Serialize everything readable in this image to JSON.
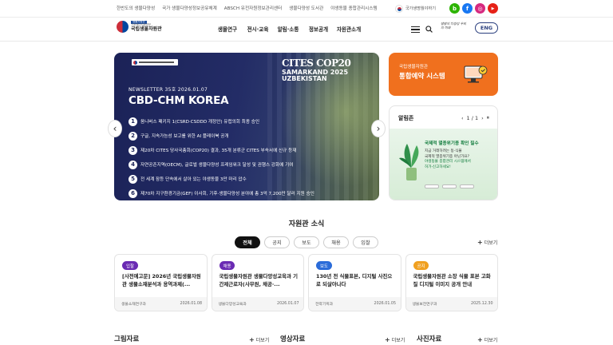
{
  "util": {
    "links": [
      "한반도의 생물다양성",
      "국가 생물다양성정보공유체계",
      "ABSCH 유전자원정보관리센터",
      "생물다양성 도서관",
      "야생동물 종합관리시스템"
    ],
    "lang_label": "국가생명월야하기",
    "sns": [
      {
        "icon": "blog-icon",
        "glyph": "b",
        "color": "#2db400"
      },
      {
        "icon": "facebook-icon",
        "glyph": "f",
        "color": "#1877f2"
      },
      {
        "icon": "instagram-icon",
        "glyph": "◎",
        "color": "#d6297f"
      },
      {
        "icon": "youtube-icon",
        "glyph": "▶",
        "color": "#e62117"
      }
    ]
  },
  "header": {
    "logo_tag": "생물자원관",
    "logo_sub": "기후에너지환경부",
    "logo_name": "국립생물자원관",
    "menu": [
      "생물연구",
      "전시·교육",
      "알림·소통",
      "정보공개",
      "자원관소개"
    ],
    "slogan": "생명의 다양성 우리의 미래",
    "eng_label": "ENG"
  },
  "hero": {
    "newsletter_label": "NEWSLETTER  35호  2026.01.07",
    "title": "CBD-CHM KOREA",
    "cites_logo": "CITES COP20",
    "cites_place": "SAMARKAND 2025 UZBEKISTAN",
    "items": [
      {
        "num": "1",
        "text": "옴니버스 패키지 1(CSRD·CSDDD 개정안) 유럽의회 최종 승인"
      },
      {
        "num": "2",
        "text": "구글, 지속가능성 보고를 위한 AI 플레이북 공개"
      },
      {
        "num": "3",
        "text": "제20차 CITES 당사국총회(COP20) 결과, 35개 분류군 CITES 부속서에 신규 등재"
      },
      {
        "num": "4",
        "text": "자연공존지역(OECM), 글로벌 생물다양성 프레임워크 달성 및 권행스 강화에 기여"
      },
      {
        "num": "5",
        "text": "전 세계 잠등 단속에서 살아 있는 야생동물 3만 마리 압수"
      },
      {
        "num": "6",
        "text": "제70차 지구환경기금(GEF) 이사회, 기후·생물다양성 분야에 총 3억 7,200만 달러 지원 승인"
      }
    ],
    "prev_glyph": "‹",
    "next_glyph": "›"
  },
  "reserve": {
    "sub": "국립생물자원관",
    "title": "통합예약 시스템"
  },
  "notice": {
    "title": "알림존",
    "prev": "‹",
    "page": "1 / 1",
    "next": "›",
    "pause": "⏸",
    "card_head": "국제적 멸종위기종 확인 필수",
    "card_lines": [
      "지금 거래하려는 동·식물",
      "국제적 멸종위기종 아닌가요?",
      "야생동물 종합관리 시스템에서",
      "허가·신고하세요!"
    ]
  },
  "news": {
    "title": "자원관 소식",
    "tabs": [
      "전체",
      "공지",
      "보도",
      "채용",
      "입찰"
    ],
    "active_tab": 0,
    "more": "더보기",
    "cards": [
      {
        "badge": "입찰",
        "badge_color": "#6a2bb3",
        "title": "[사전예고문] 2026년 국립생물자원관 생물소재분석과 용역과제(...",
        "dept": "생물소재연구과",
        "date": "2026.01.08"
      },
      {
        "badge": "채용",
        "badge_color": "#6a2bb3",
        "title": "국립생물자원관 생물다양성교육과 기간제근로자(사무원, 채공·...",
        "dept": "생물다양성교육과",
        "date": "2026.01.07"
      },
      {
        "badge": "보도",
        "badge_color": "#2b6cd9",
        "title": "130년 전 식물표본, 디지털 사진으로 되살아나다",
        "dept": "전략기획과",
        "date": "2026.01.05"
      },
      {
        "badge": "공지",
        "badge_color": "#f0a020",
        "title": "국립생물자원관 소장 식물 표본 고화질 디지털 이미지 공개 안내",
        "dept": "생물보전연구과",
        "date": "2025.12.30"
      }
    ]
  },
  "bottom": {
    "sections": [
      "그림자료",
      "영상자료",
      "사진자료"
    ],
    "more": "더보기"
  }
}
